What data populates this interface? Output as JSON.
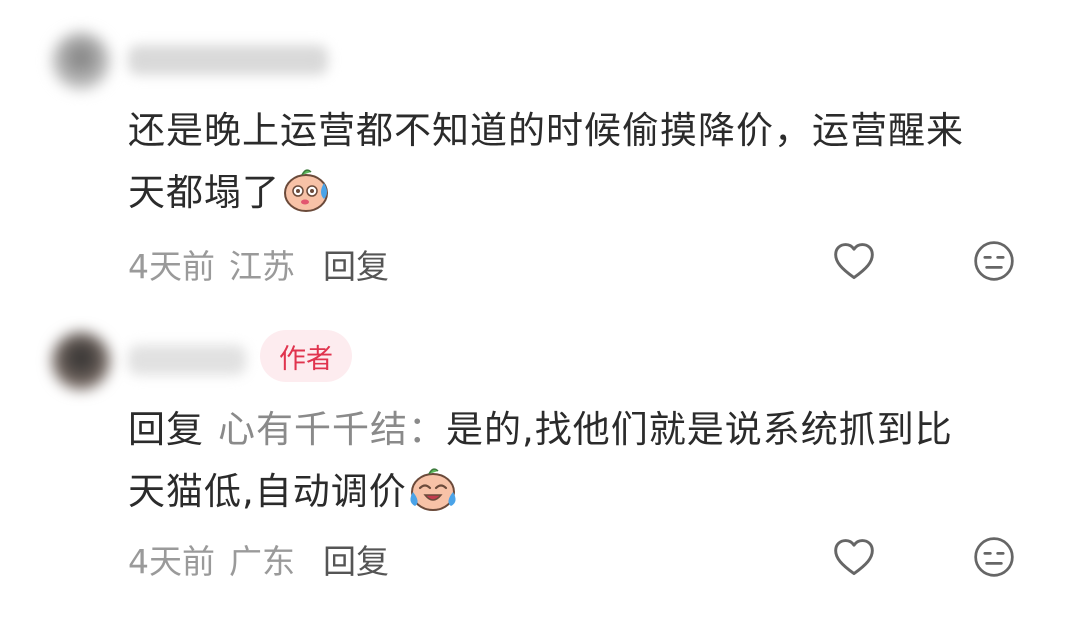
{
  "comments": [
    {
      "text_line1": "还是晚上运营都不知道的时候偷摸降价，运营醒来",
      "text_line2": "天都塌了",
      "emoji": "sweat-face-emoji",
      "time": "4天前",
      "location": "江苏",
      "reply_label": "回复",
      "icons": [
        "heart-outline-icon",
        "neutral-face-icon"
      ]
    },
    {
      "author_badge": "作者",
      "reply_prefix": "回复",
      "reply_target": "心有千千结：",
      "text_line1_rest": "是的,找他们就是说系统抓到比",
      "text_line2": "天猫低,自动调价",
      "emoji": "crying-laughing-emoji",
      "time": "4天前",
      "location": "广东",
      "reply_label": "回复",
      "icons": [
        "heart-outline-icon",
        "neutral-face-icon"
      ]
    }
  ],
  "colors": {
    "text": "#2b2b2b",
    "meta": "#9a9a9a",
    "badge_bg": "#fdecef",
    "badge_text": "#e0344e"
  }
}
